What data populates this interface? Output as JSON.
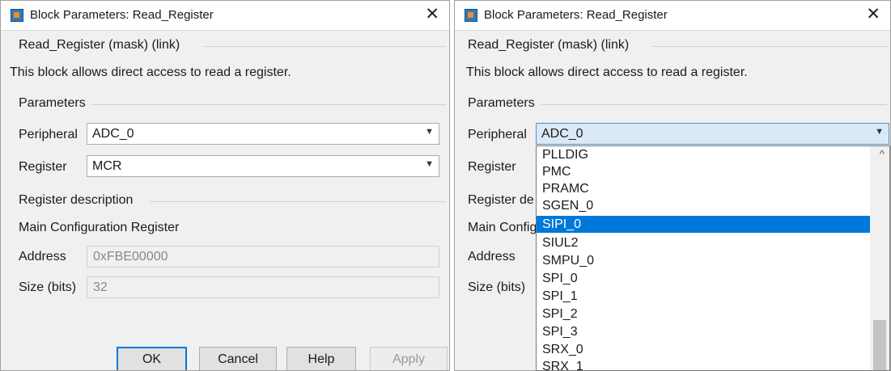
{
  "left_dialog": {
    "title": "Block Parameters: Read_Register",
    "header": "Read_Register (mask) (link)",
    "description": "This block allows direct access to read a register.",
    "parameters_label": "Parameters",
    "peripheral_label": "Peripheral",
    "peripheral_value": "ADC_0",
    "register_label": "Register",
    "register_value": "MCR",
    "register_desc_label": "Register description",
    "register_desc_text": "Main Configuration Register",
    "address_label": "Address",
    "address_value": "0xFBE00000",
    "size_label": "Size (bits)",
    "size_value": "32",
    "buttons": {
      "ok": "OK",
      "cancel": "Cancel",
      "help": "Help",
      "apply": "Apply"
    }
  },
  "right_dialog": {
    "title": "Block Parameters: Read_Register",
    "header": "Read_Register (mask) (link)",
    "description": "This block allows direct access to read a register.",
    "parameters_label": "Parameters",
    "peripheral_label": "Peripheral",
    "peripheral_value": "ADC_0",
    "register_label": "Register",
    "register_desc_label": "Register de",
    "register_desc_text": "Main Config",
    "address_label": "Address",
    "size_label": "Size (bits)",
    "dropdown_items": [
      "PLLDIG",
      "PMC",
      "PRAMC",
      "SGEN_0",
      "SIPI_0",
      "SIUL2",
      "SMPU_0",
      "SPI_0",
      "SPI_1",
      "SPI_2",
      "SPI_3",
      "SRX_0",
      "SRX_1"
    ],
    "dropdown_selected": "SIPI_0"
  },
  "icons": {
    "app": "simulink-block-icon",
    "close": "close-icon",
    "arrow": "dropdown-arrow-icon"
  },
  "colors": {
    "selection": "#0078d7",
    "active_combo": "#dbe9f6",
    "dialog_bg": "#f0f0f0"
  }
}
